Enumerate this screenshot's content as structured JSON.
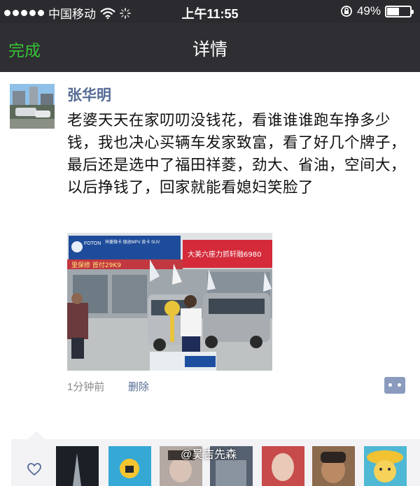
{
  "status_bar": {
    "carrier": "中国移动",
    "time": "上午11:55",
    "battery_percent": "49%",
    "battery_level": 0.49,
    "icons": [
      "signal-dots-icon",
      "wifi-icon",
      "activity-spinner-icon",
      "rotation-lock-icon",
      "battery-icon"
    ]
  },
  "nav": {
    "done_label": "完成",
    "title": "详情",
    "done_color": "#35c435"
  },
  "post": {
    "author": "张华明",
    "text": "老婆天天在家叨叨没钱花，看谁谁谁跑车挣多少钱，我也决心买辆车发家致富，看了好几个牌子，最后还是选中了福田祥菱，劲大、省油，空间大，以后挣钱了，回家就能看媳妇笑脸了",
    "time": "1分钟前",
    "delete_label": "删除",
    "image_signs": {
      "dealer_logo": "FOTON",
      "sign_left": "祥菱微卡 伽途MPV 皮卡 SUV",
      "sign_red": "大美六座力抓轩融6980",
      "banner": "里保修 首付29K9"
    }
  },
  "likes": {
    "watermark": "@吴吉先森",
    "count_avatars": 8
  },
  "colors": {
    "link": "#556b95",
    "bar_bg": "#2f2e33"
  }
}
